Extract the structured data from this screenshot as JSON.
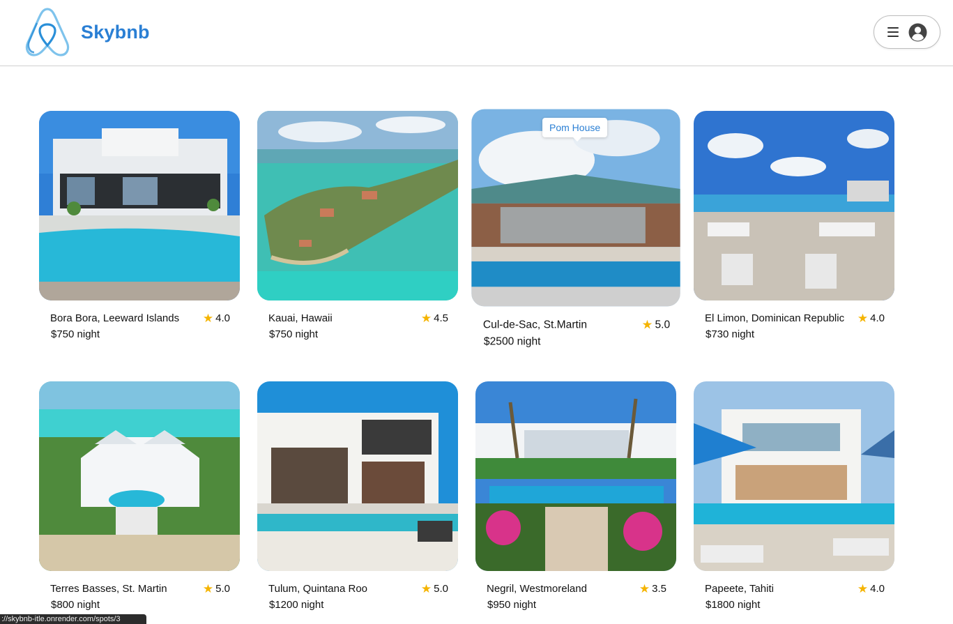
{
  "header": {
    "brand_name": "Skybnb"
  },
  "tooltip": {
    "text": "Pom House"
  },
  "listings": [
    {
      "location": "Bora Bora, Leeward Islands",
      "rating": "4.0",
      "price": "$750 night"
    },
    {
      "location": "Kauai, Hawaii",
      "rating": "4.5",
      "price": "$750 night"
    },
    {
      "location": "Cul-de-Sac, St.Martin",
      "rating": "5.0",
      "price": "$2500 night"
    },
    {
      "location": "El Limon, Dominican Republic",
      "rating": "4.0",
      "price": "$730 night"
    },
    {
      "location": "Terres Basses, St. Martin",
      "rating": "5.0",
      "price": "$800 night"
    },
    {
      "location": "Tulum, Quintana Roo",
      "rating": "5.0",
      "price": "$1200 night"
    },
    {
      "location": "Negril, Westmoreland",
      "rating": "3.5",
      "price": "$950 night"
    },
    {
      "location": "Papeete, Tahiti",
      "rating": "4.0",
      "price": "$1800 night"
    }
  ],
  "status_bar": {
    "url": "://skybnb-itle.onrender.com/spots/3"
  },
  "colors": {
    "brand": "#2a7fd4",
    "star": "#f5b400"
  }
}
